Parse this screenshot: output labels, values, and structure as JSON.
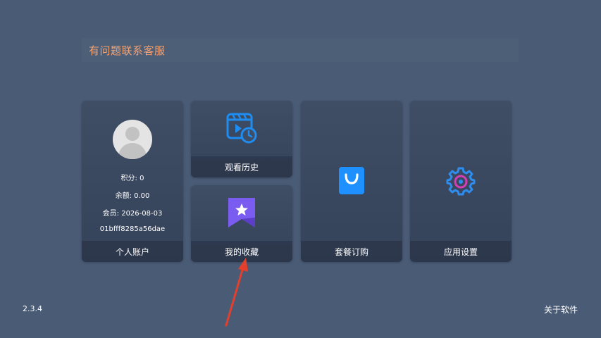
{
  "notice": {
    "text": "有问题联系客服"
  },
  "account": {
    "points": "积分: 0",
    "balance": "余额: 0.00",
    "member": "会员: 2026-08-03",
    "device_id": "01bfff8285a56dae",
    "label": "个人账户"
  },
  "history": {
    "label": "观看历史",
    "icon": "video-history-icon"
  },
  "favorites": {
    "label": "我的收藏",
    "icon": "star-bookmark-icon"
  },
  "package": {
    "label": "套餐订购",
    "icon": "shopping-bag-icon"
  },
  "settings": {
    "label": "应用设置",
    "icon": "gear-icon"
  },
  "footer": {
    "version": "2.3.4",
    "about": "关于软件"
  },
  "colors": {
    "background": "#4a5b76",
    "notice_text": "#f5a273",
    "history_icon": "#1e8cf0",
    "favorites_icon": "#7b5cf0",
    "package_icon": "#1e90ff",
    "settings_icon": "#2e8ef0",
    "settings_icon_inner": "#d23fb5",
    "annotation_arrow": "#e2402c"
  }
}
